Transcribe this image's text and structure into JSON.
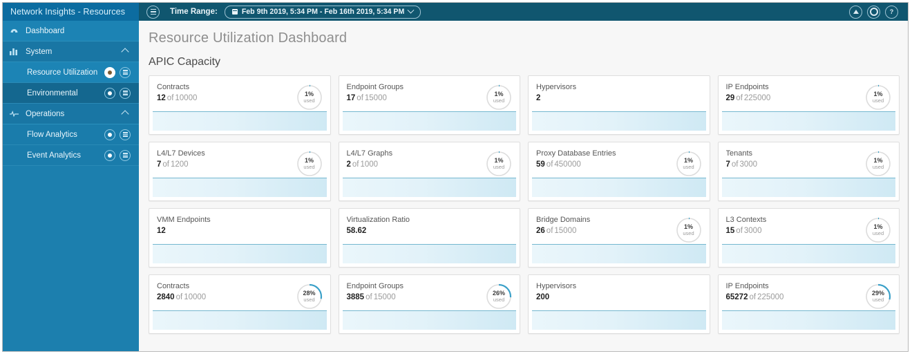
{
  "brand": {
    "title": "Network Insights - Resources"
  },
  "topbar": {
    "menu_icon": "hamburger-icon",
    "time_range_label": "Time Range:",
    "time_range_value": "Feb 9th 2019, 5:34 PM - Feb 16th 2019, 5:34 PM",
    "calendar_icon": "calendar-icon",
    "chevron_icon": "chevron-down-icon",
    "right_buttons": [
      {
        "icon": "up-arrow-icon",
        "glyph": ""
      },
      {
        "icon": "gear-icon",
        "glyph": ""
      },
      {
        "icon": "help-icon",
        "glyph": "?"
      }
    ]
  },
  "sidebar": {
    "items": [
      {
        "label": "Dashboard",
        "icon": "dashboard-icon",
        "type": "top"
      },
      {
        "label": "System",
        "icon": "bar-chart-icon",
        "type": "group",
        "expanded": true
      },
      {
        "label": "Resource Utilization",
        "type": "sub",
        "selected": true,
        "icons": [
          "record-dot-icon",
          "list-icon"
        ]
      },
      {
        "label": "Environmental",
        "type": "sub",
        "selected": false,
        "icons": [
          "record-dot-icon",
          "list-icon"
        ]
      },
      {
        "label": "Operations",
        "icon": "pulse-icon",
        "type": "group",
        "expanded": true
      },
      {
        "label": "Flow Analytics",
        "type": "sub",
        "selected": false,
        "icons": [
          "record-dot-icon",
          "list-icon"
        ]
      },
      {
        "label": "Event Analytics",
        "type": "sub",
        "selected": false,
        "icons": [
          "record-dot-icon",
          "list-icon"
        ]
      }
    ]
  },
  "main": {
    "page_title": "Resource Utilization Dashboard",
    "section_title": "APIC Capacity",
    "of_word": "of",
    "used_word": "used",
    "cards": [
      {
        "title": "Contracts",
        "value": "12",
        "max": "10000",
        "percent": "1%",
        "percent_num": 1,
        "has_gauge": true
      },
      {
        "title": "Endpoint Groups",
        "value": "17",
        "max": "15000",
        "percent": "1%",
        "percent_num": 1,
        "has_gauge": true
      },
      {
        "title": "Hypervisors",
        "value": "2",
        "max": "",
        "percent": "",
        "percent_num": 0,
        "has_gauge": false
      },
      {
        "title": "IP Endpoints",
        "value": "29",
        "max": "225000",
        "percent": "1%",
        "percent_num": 1,
        "has_gauge": true
      },
      {
        "title": "L4/L7 Devices",
        "value": "7",
        "max": "1200",
        "percent": "1%",
        "percent_num": 1,
        "has_gauge": true
      },
      {
        "title": "L4/L7 Graphs",
        "value": "2",
        "max": "1000",
        "percent": "1%",
        "percent_num": 1,
        "has_gauge": true
      },
      {
        "title": "Proxy Database Entries",
        "value": "59",
        "max": "450000",
        "percent": "1%",
        "percent_num": 1,
        "has_gauge": true
      },
      {
        "title": "Tenants",
        "value": "7",
        "max": "3000",
        "percent": "1%",
        "percent_num": 1,
        "has_gauge": true
      },
      {
        "title": "VMM Endpoints",
        "value": "12",
        "max": "",
        "percent": "",
        "percent_num": 0,
        "has_gauge": false
      },
      {
        "title": "Virtualization Ratio",
        "value": "58.62",
        "max": "",
        "percent": "",
        "percent_num": 0,
        "has_gauge": false
      },
      {
        "title": "Bridge Domains",
        "value": "26",
        "max": "15000",
        "percent": "1%",
        "percent_num": 1,
        "has_gauge": true
      },
      {
        "title": "L3 Contexts",
        "value": "15",
        "max": "3000",
        "percent": "1%",
        "percent_num": 1,
        "has_gauge": true
      },
      {
        "title": "Contracts",
        "value": "2840",
        "max": "10000",
        "percent": "28%",
        "percent_num": 28,
        "has_gauge": true
      },
      {
        "title": "Endpoint Groups",
        "value": "3885",
        "max": "15000",
        "percent": "26%",
        "percent_num": 26,
        "has_gauge": true
      },
      {
        "title": "Hypervisors",
        "value": "200",
        "max": "",
        "percent": "",
        "percent_num": 0,
        "has_gauge": false
      },
      {
        "title": "IP Endpoints",
        "value": "65272",
        "max": "225000",
        "percent": "29%",
        "percent_num": 29,
        "has_gauge": true
      }
    ]
  },
  "colors": {
    "brand_blue": "#0c6ca0",
    "topbar_blue": "#10566f",
    "sidebar_blue": "#1c7fae",
    "accent_arc": "#3aa0c8",
    "ring_track": "#dcdcdc",
    "spark_line": "#74b7cf"
  }
}
